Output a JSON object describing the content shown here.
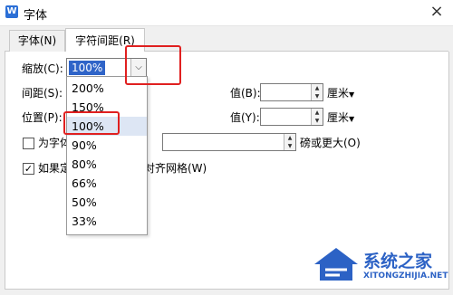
{
  "window": {
    "title": "字体",
    "app_icon_letter": "W",
    "close_glyph": "×"
  },
  "tabs": [
    {
      "label": "字体(N)"
    },
    {
      "label": "字符间距(R)"
    }
  ],
  "form": {
    "scale_label": "缩放(C):",
    "scale_value": "100%",
    "spacing_label": "间距(S):",
    "position_label": "位置(P):",
    "value_b_label": "值(B):",
    "value_y_label": "值(Y):",
    "unit_label": "厘米",
    "kerning_checkbox_label": "为字体",
    "kerning_suffix": "磅或更大(O)",
    "grid_checkbox_label": "如果定",
    "grid_checkbox_suffix": "则对齐网格(W)",
    "grid_checked": true,
    "kerning_checked": false
  },
  "scale_options": [
    "200%",
    "150%",
    "100%",
    "90%",
    "80%",
    "66%",
    "50%",
    "33%"
  ],
  "selected_scale_index": 2,
  "watermark": {
    "brand": "系统之家",
    "url": "XITONGZHIJIA.NET"
  },
  "colors": {
    "accent": "#2f64c8",
    "highlight_box": "#e02020",
    "watermark": "#2c62c5"
  }
}
